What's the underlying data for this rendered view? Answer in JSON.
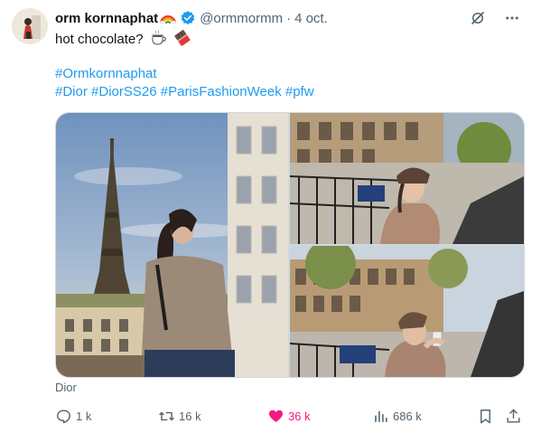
{
  "author": {
    "display_name": "orm kornnaphat",
    "handle": "@ormmormm",
    "time": "4 oct."
  },
  "post": {
    "text": "hot chocolate?",
    "hashtags_line1": [
      "#Ormkornnaphat"
    ],
    "hashtags_line2": [
      "#Dior",
      "#DiorSS26",
      "#ParisFashionWeek",
      "#pfw"
    ],
    "media_caption": "Dior"
  },
  "actions": {
    "replies": "1 k",
    "reposts": "16 k",
    "likes": "36 k",
    "views": "686 k"
  },
  "icons": [
    "rainbow-emoji",
    "verified-badge-icon",
    "grok-icon",
    "more-icon",
    "coffee-emoji",
    "chocolate-emoji",
    "reply-icon",
    "repost-icon",
    "heart-icon",
    "views-icon",
    "bookmark-icon",
    "share-icon"
  ],
  "colors": {
    "accent": "#1d9bf0",
    "like": "#f91880",
    "muted": "#536471",
    "text": "#0f1419"
  }
}
